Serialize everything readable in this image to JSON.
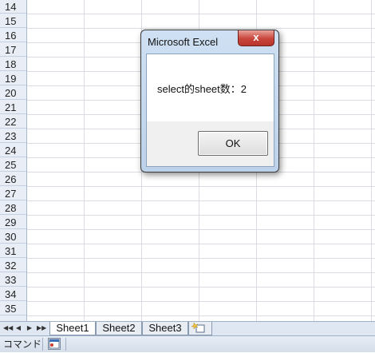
{
  "grid": {
    "rows": [
      "14",
      "15",
      "16",
      "17",
      "18",
      "19",
      "20",
      "21",
      "22",
      "23",
      "24",
      "25",
      "26",
      "27",
      "28",
      "29",
      "30",
      "31",
      "32",
      "33",
      "34",
      "35"
    ]
  },
  "tabbar": {
    "nav": [
      "◀◀",
      "◀",
      "▶",
      "▶▶"
    ],
    "sheets": [
      "Sheet1",
      "Sheet2",
      "Sheet3"
    ],
    "active_sheet": "Sheet1"
  },
  "statusbar": {
    "mode": "コマンド"
  },
  "dialog": {
    "title": "Microsoft Excel",
    "close_label": "x",
    "message": "select的sheet数：2",
    "ok_label": "OK"
  },
  "colors": {
    "close_button": "#c8453a",
    "dialog_frame": "#cfe0f3"
  }
}
